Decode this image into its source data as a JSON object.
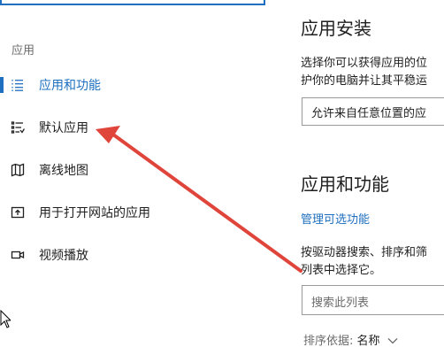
{
  "nav": {
    "section_label": "应用",
    "items": [
      {
        "label": "应用和功能",
        "icon": "apps-features-icon",
        "active": true
      },
      {
        "label": "默认应用",
        "icon": "default-apps-icon",
        "active": false
      },
      {
        "label": "离线地图",
        "icon": "offline-maps-icon",
        "active": false
      },
      {
        "label": "用于打开网站的应用",
        "icon": "apps-for-websites-icon",
        "active": false
      },
      {
        "label": "视频播放",
        "icon": "video-playback-icon",
        "active": false
      }
    ]
  },
  "install": {
    "title": "应用安装",
    "desc_line1": "选择你可以获得应用的位",
    "desc_line2": "护你的电脑并让其平稳运",
    "dropdown_value": "允许来自任意位置的应"
  },
  "features": {
    "title": "应用和功能",
    "manage_link": "管理可选功能",
    "desc_line1": "按驱动器搜索、排序和筛",
    "desc_line2": "列表中选择它。",
    "search_placeholder": "搜索此列表",
    "sort_label": "排序依据:",
    "sort_value": "名称"
  },
  "colors": {
    "accent": "#1e6fbf",
    "annotation_arrow": "#e0453c"
  }
}
